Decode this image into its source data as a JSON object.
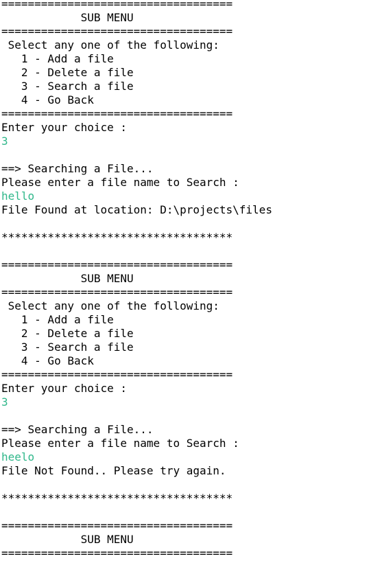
{
  "console": {
    "text_color": "#000000",
    "input_color": "#2fb78a",
    "lines": [
      {
        "type": "separator",
        "text": "==================================="
      },
      {
        "type": "output",
        "text": "            SUB MENU"
      },
      {
        "type": "separator",
        "text": "==================================="
      },
      {
        "type": "output",
        "text": " Select any one of the following:"
      },
      {
        "type": "output",
        "text": "   1 - Add a file"
      },
      {
        "type": "output",
        "text": "   2 - Delete a file"
      },
      {
        "type": "output",
        "text": "   3 - Search a file"
      },
      {
        "type": "output",
        "text": "   4 - Go Back"
      },
      {
        "type": "separator",
        "text": "==================================="
      },
      {
        "type": "output",
        "text": "Enter your choice :"
      },
      {
        "type": "input",
        "text": "3"
      },
      {
        "type": "blank",
        "text": ""
      },
      {
        "type": "output",
        "text": "==> Searching a File..."
      },
      {
        "type": "output",
        "text": "Please enter a file name to Search :"
      },
      {
        "type": "input",
        "text": "hello"
      },
      {
        "type": "output",
        "text": "File Found at location: D:\\projects\\files"
      },
      {
        "type": "blank",
        "text": ""
      },
      {
        "type": "separator",
        "text": "***********************************"
      },
      {
        "type": "blank",
        "text": ""
      },
      {
        "type": "separator",
        "text": "==================================="
      },
      {
        "type": "output",
        "text": "            SUB MENU"
      },
      {
        "type": "separator",
        "text": "==================================="
      },
      {
        "type": "output",
        "text": " Select any one of the following:"
      },
      {
        "type": "output",
        "text": "   1 - Add a file"
      },
      {
        "type": "output",
        "text": "   2 - Delete a file"
      },
      {
        "type": "output",
        "text": "   3 - Search a file"
      },
      {
        "type": "output",
        "text": "   4 - Go Back"
      },
      {
        "type": "separator",
        "text": "==================================="
      },
      {
        "type": "output",
        "text": "Enter your choice :"
      },
      {
        "type": "input",
        "text": "3"
      },
      {
        "type": "blank",
        "text": ""
      },
      {
        "type": "output",
        "text": "==> Searching a File..."
      },
      {
        "type": "output",
        "text": "Please enter a file name to Search :"
      },
      {
        "type": "input",
        "text": "heelo"
      },
      {
        "type": "output",
        "text": "File Not Found.. Please try again."
      },
      {
        "type": "blank",
        "text": ""
      },
      {
        "type": "separator",
        "text": "***********************************"
      },
      {
        "type": "blank",
        "text": ""
      },
      {
        "type": "separator",
        "text": "==================================="
      },
      {
        "type": "output",
        "text": "            SUB MENU"
      },
      {
        "type": "separator",
        "text": "==================================="
      }
    ]
  }
}
